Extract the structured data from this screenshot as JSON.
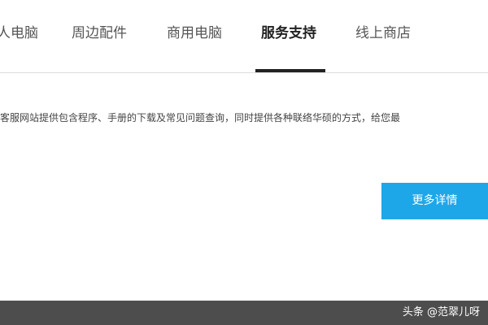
{
  "nav": {
    "items": [
      {
        "label": "人电脑"
      },
      {
        "label": "周边配件"
      },
      {
        "label": "商用电脑"
      },
      {
        "label": "服务支持"
      },
      {
        "label": "线上商店"
      }
    ],
    "active_index": 3
  },
  "main": {
    "description": "客服网站提供包含程序、手册的下载及常见问题查询，同时提供各种联络华硕的方式，给您最",
    "more_button_label": "更多详情"
  },
  "footer": {
    "watermark": "头条 @范翠儿呀"
  },
  "colors": {
    "accent": "#1ea7e8",
    "active_underline": "#222222",
    "footer_bar": "#4d4d4d"
  }
}
